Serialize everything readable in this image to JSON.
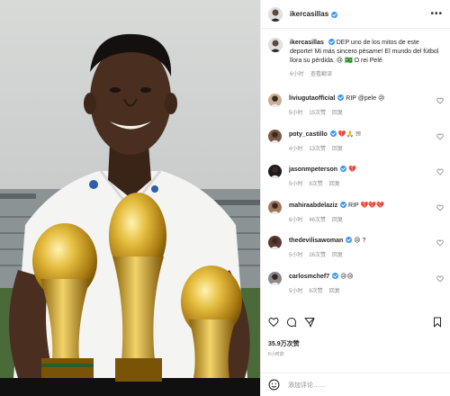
{
  "post": {
    "username": "ikercasillas",
    "more_label": "•••",
    "caption_user": "ikercasillas",
    "caption_text": "DEP uno de los mitos de este deporte! Mi más sincero pésame! El mundo del fútbol llora su pérdida. 😢 🇧🇷 O rei Pelé",
    "caption_time": "6小时",
    "caption_translate": "查看翻译"
  },
  "comments": [
    {
      "user": "liviugutaofficial",
      "verified": true,
      "text": "RIP @pele 😢",
      "time": "5小时",
      "likes": "15次赞",
      "reply": "回复"
    },
    {
      "user": "poty_castillo",
      "verified": true,
      "text": "💔🙏 !!!",
      "time": "4小时",
      "likes": "13次赞",
      "reply": "回复"
    },
    {
      "user": "jasonmpeterson",
      "verified": true,
      "text": "💔",
      "time": "5小时",
      "likes": "8次赞",
      "reply": "回复"
    },
    {
      "user": "mahiraabdelaziz",
      "verified": true,
      "text": "RIP 💔💔💔",
      "time": "6小时",
      "likes": "46次赞",
      "reply": "回复"
    },
    {
      "user": "thedevilisawoman",
      "verified": true,
      "text": "😢 ?",
      "time": "5小时",
      "likes": "26次赞",
      "reply": "回复"
    },
    {
      "user": "carlosmchef7",
      "verified": true,
      "text": "😢😢",
      "time": "5小时",
      "likes": "6次赞",
      "reply": "回复"
    }
  ],
  "footer": {
    "likes": "35.9万次赞",
    "time": "6小时前",
    "comment_placeholder": "添加评论……"
  },
  "colors": {
    "verified": "#3897f0",
    "text": "#262626",
    "muted": "#8e8e8e",
    "gold": "#c9a227"
  }
}
